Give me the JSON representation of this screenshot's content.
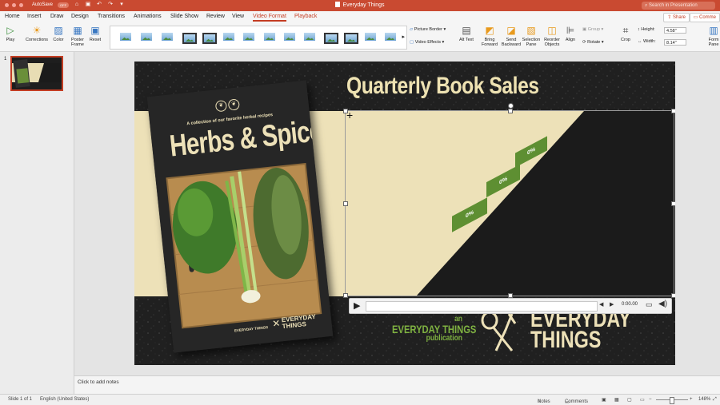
{
  "window": {
    "document_title": "Everyday Things",
    "autosave_label": "AutoSave",
    "autosave_state": "OFF",
    "search_placeholder": "Search in Presentation"
  },
  "tabs": [
    "Home",
    "Insert",
    "Draw",
    "Design",
    "Transitions",
    "Animations",
    "Slide Show",
    "Review",
    "View",
    "Video Format",
    "Playback"
  ],
  "active_tab": "Video Format",
  "share_label": "Share",
  "comments_label": "Comme",
  "ribbon": {
    "play": "Play",
    "corrections": "Corrections",
    "color": "Color",
    "poster_frame": "Poster Frame",
    "reset": "Reset",
    "picture_border": "Picture Border",
    "video_effects": "Video Effects",
    "alt_text": "Alt Text",
    "bring_forward": "Bring Forward",
    "send_backward": "Send Backward",
    "selection_pane": "Selection Pane",
    "reorder_objects": "Reorder Objects",
    "align": "Align",
    "group": "Group",
    "rotate": "Rotate",
    "crop": "Crop",
    "height_label": "Height:",
    "height_value": "4.58\"",
    "width_label": "Width:",
    "width_value": "8.14\"",
    "format_pane": "Form Pane"
  },
  "sidebar": {
    "slide_number": "1"
  },
  "slide": {
    "title": "Quarterly Book Sales",
    "book": {
      "tagline": "A collection of our favorite herbal recipes",
      "title": "Herbs & Spices",
      "footer_left": "EVERYDAY THINGS",
      "footer_right_1": "EVERYDAY",
      "footer_right_2": "THINGS"
    },
    "bars": [
      "0%",
      "0%",
      "0%"
    ],
    "publisher_line1": "an",
    "publisher_line2": "EVERYDAY THINGS",
    "publisher_line3": "publication",
    "logo_line1": "EVERYDAY",
    "logo_line2": "THINGS",
    "video_time": "0:00.00"
  },
  "notes_placeholder": "Click to add notes",
  "status": {
    "slide_info": "Slide 1 of 1",
    "language": "English (United States)",
    "notes": "Notes",
    "comments": "Comments",
    "zoom": "148%"
  },
  "colors": {
    "accent": "#c43d23",
    "slide_cream": "#ede1b8",
    "bar_green": "#5e8f32",
    "title_cream": "#eee2b2",
    "green_text": "#7fb241"
  }
}
